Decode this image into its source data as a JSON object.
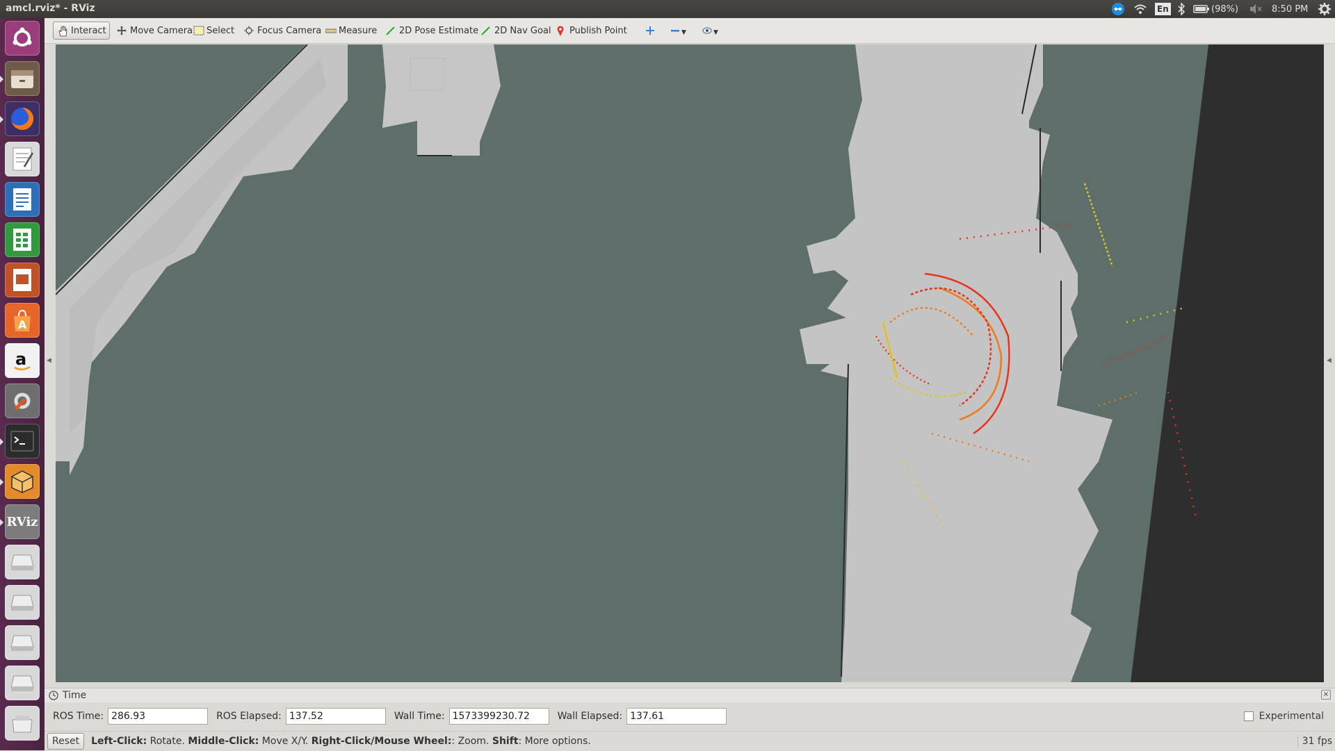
{
  "window": {
    "title": "amcl.rviz* - RViz"
  },
  "indicators": {
    "keyboard": "En",
    "battery": "(98%)",
    "clock": "8:50 PM"
  },
  "launcher": [
    {
      "name": "ubuntu-dash-icon",
      "color": "#8f3a72"
    },
    {
      "name": "files-icon",
      "color": "#6b5a45"
    },
    {
      "name": "firefox-icon",
      "color": "#d4561b"
    },
    {
      "name": "text-editor-icon",
      "color": "#e8e8e8"
    },
    {
      "name": "writer-icon",
      "color": "#2a6db5"
    },
    {
      "name": "calc-icon",
      "color": "#2f9a3e"
    },
    {
      "name": "impress-icon",
      "color": "#c0522a"
    },
    {
      "name": "software-center-icon",
      "color": "#e8652a"
    },
    {
      "name": "amazon-icon",
      "color": "#f2f2f2"
    },
    {
      "name": "system-settings-icon",
      "color": "#7a7a7a"
    },
    {
      "name": "terminal-icon",
      "color": "#2c2c2c"
    },
    {
      "name": "virtualbox-icon",
      "color": "#e58a2a"
    },
    {
      "name": "rviz-icon",
      "color": "#7c7c7c",
      "text": "RViz"
    },
    {
      "name": "drive-icon",
      "color": "#d8d8d8"
    },
    {
      "name": "drive-icon",
      "color": "#d8d8d8"
    },
    {
      "name": "drive-icon",
      "color": "#d8d8d8"
    },
    {
      "name": "drive-icon",
      "color": "#d8d8d8"
    },
    {
      "name": "trash-icon",
      "color": "#d8d8d8"
    }
  ],
  "toolbar": {
    "interact": "Interact",
    "move_camera": "Move Camera",
    "select": "Select",
    "focus_camera": "Focus Camera",
    "measure": "Measure",
    "pose_estimate": "2D Pose Estimate",
    "nav_goal": "2D Nav Goal",
    "publish_point": "Publish Point"
  },
  "time_panel": {
    "title": "Time",
    "ros_time_label": "ROS Time:",
    "ros_time": "286.93",
    "ros_elapsed_label": "ROS Elapsed:",
    "ros_elapsed": "137.52",
    "wall_time_label": "Wall Time:",
    "wall_time": "1573399230.72",
    "wall_elapsed_label": "Wall Elapsed:",
    "wall_elapsed": "137.61",
    "experimental_label": "Experimental"
  },
  "status": {
    "reset": "Reset",
    "left_click": "Left-Click:",
    "left_click_action": " Rotate. ",
    "middle_click": "Middle-Click:",
    "middle_click_action": " Move X/Y. ",
    "right_click": "Right-Click/Mouse Wheel:",
    "right_click_action": ": Zoom. ",
    "shift": "Shift",
    "shift_action": ": More options.",
    "fps": "31 fps"
  },
  "colors": {
    "map_unknown": "#5e6e6b",
    "map_free": "#c4c4c4",
    "map_dark": "#2e2e2e",
    "scan_red": "#e8341c",
    "scan_orange": "#f07a18",
    "scan_yellow": "#e0c31c"
  }
}
